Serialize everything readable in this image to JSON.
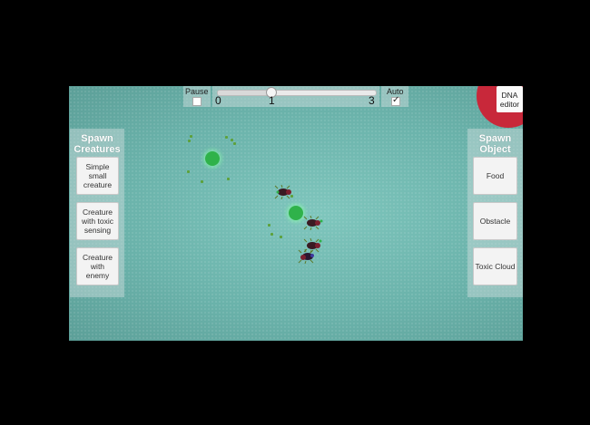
{
  "top_bar": {
    "pause_label": "Pause",
    "pause_checked": false,
    "speed_ticks": [
      "0",
      "1",
      "3"
    ],
    "speed_value": 1,
    "auto_label": "Auto",
    "auto_checked": true
  },
  "dna_editor": {
    "label_line1": "DNA",
    "label_line2": "editor"
  },
  "left_panel": {
    "title_line1": "Spawn",
    "title_line2": "Creatures",
    "buttons": [
      {
        "lines": [
          "Simple",
          "small",
          "creature"
        ]
      },
      {
        "lines": [
          "Creature",
          "with toxic",
          "sensing"
        ]
      },
      {
        "lines": [
          "Creature",
          "with",
          "enemy"
        ]
      }
    ]
  },
  "right_panel": {
    "title_line1": "Spawn",
    "title_line2": "Object",
    "buttons": [
      "Food",
      "Obstacle",
      "Toxic Cloud"
    ]
  },
  "colors": {
    "background": "#6bb3ab",
    "food": "#2fb24a",
    "dna_circle": "#c8283a",
    "creature_body": "#3a1a22"
  }
}
